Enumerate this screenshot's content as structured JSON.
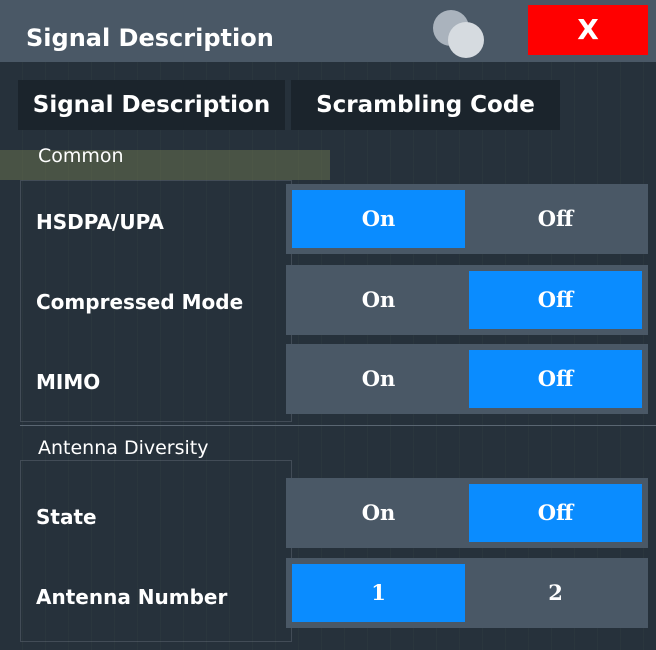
{
  "window": {
    "title": "Signal Description",
    "close_label": "X"
  },
  "tabs": [
    {
      "label": "Signal Description",
      "active": true
    },
    {
      "label": "Scrambling Code",
      "active": false
    }
  ],
  "sections": {
    "common": "Common",
    "antenna_diversity": "Antenna Diversity"
  },
  "settings": [
    {
      "label": "HSDPA/UPA",
      "options": [
        "On",
        "Off"
      ],
      "selected": "On"
    },
    {
      "label": "Compressed Mode",
      "options": [
        "On",
        "Off"
      ],
      "selected": "Off"
    },
    {
      "label": "MIMO",
      "options": [
        "On",
        "Off"
      ],
      "selected": "Off"
    },
    {
      "label": "State",
      "options": [
        "On",
        "Off"
      ],
      "selected": "Off"
    },
    {
      "label": "Antenna Number",
      "options": [
        "1",
        "2"
      ],
      "selected": "1"
    }
  ],
  "colors": {
    "accent": "#0a8cff",
    "close": "#ff0000",
    "titlebar": "#4a5866",
    "panel": "#26313b"
  }
}
